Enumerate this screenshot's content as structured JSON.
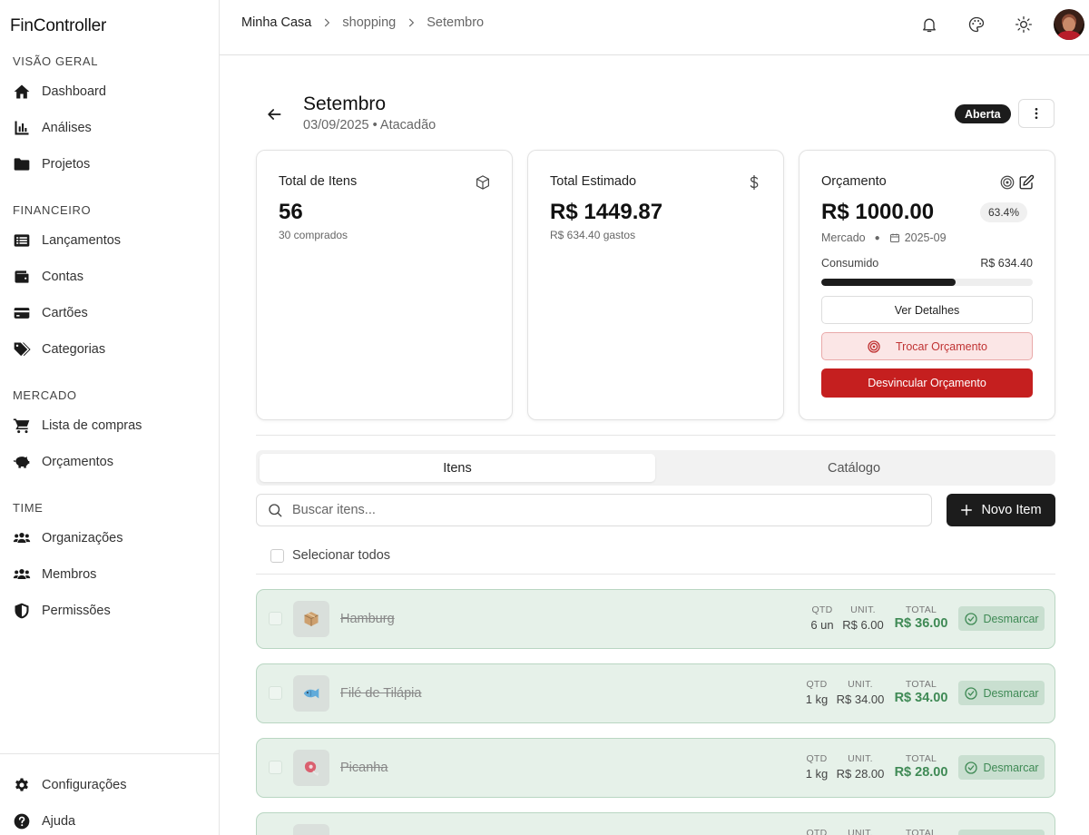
{
  "app": {
    "name": "FinController"
  },
  "sidebar": {
    "sections": [
      {
        "label": "VISÃO GERAL",
        "items": [
          {
            "label": "Dashboard",
            "icon": "home-icon"
          },
          {
            "label": "Análises",
            "icon": "chart-icon"
          },
          {
            "label": "Projetos",
            "icon": "folder-icon"
          }
        ]
      },
      {
        "label": "FINANCEIRO",
        "items": [
          {
            "label": "Lançamentos",
            "icon": "list-icon"
          },
          {
            "label": "Contas",
            "icon": "wallet-icon"
          },
          {
            "label": "Cartões",
            "icon": "credit-card-icon"
          },
          {
            "label": "Categorias",
            "icon": "tags-icon"
          }
        ]
      },
      {
        "label": "MERCADO",
        "items": [
          {
            "label": "Lista de compras",
            "icon": "cart-icon"
          },
          {
            "label": "Orçamentos",
            "icon": "piggy-bank-icon"
          }
        ]
      },
      {
        "label": "TIME",
        "items": [
          {
            "label": "Organizações",
            "icon": "users-icon"
          },
          {
            "label": "Membros",
            "icon": "users-icon"
          },
          {
            "label": "Permissões",
            "icon": "shield-icon"
          }
        ]
      }
    ],
    "footer": [
      {
        "label": "Configurações",
        "icon": "gear-icon"
      },
      {
        "label": "Ajuda",
        "icon": "help-icon"
      }
    ]
  },
  "header": {
    "breadcrumb": [
      "Minha Casa",
      "shopping",
      "Setembro"
    ],
    "icons": [
      "bell-icon",
      "palette-icon",
      "sun-icon"
    ]
  },
  "page": {
    "title": "Setembro",
    "subtitle_date": "03/09/2025",
    "subtitle_store": "Atacadão",
    "status": "Aberta"
  },
  "cards": {
    "items": {
      "title": "Total de Itens",
      "value": "56",
      "sub": "30 comprados"
    },
    "estimated": {
      "title": "Total Estimado",
      "value": "R$ 1449.87",
      "sub": "R$ 634.40 gastos"
    },
    "budget": {
      "title": "Orçamento",
      "value": "R$ 1000.00",
      "percent": "63.4%",
      "category": "Mercado",
      "period": "2025-09",
      "consumed_label": "Consumido",
      "consumed_value": "R$ 634.40",
      "consumed_fraction": 0.634,
      "details_label": "Ver Detalhes",
      "swap_label": "Trocar Orçamento",
      "unlink_label": "Desvincular Orçamento"
    }
  },
  "tabs": [
    {
      "label": "Itens",
      "active": true
    },
    {
      "label": "Catálogo",
      "active": false
    }
  ],
  "search": {
    "placeholder": "Buscar itens..."
  },
  "new_item_label": "Novo Item",
  "select_all_label": "Selecionar todos",
  "list": {
    "headers": {
      "qty": "QTD",
      "unit": "UNIT.",
      "total": "TOTAL"
    },
    "unmark_label": "Desmarcar",
    "items": [
      {
        "name": "Hamburg",
        "qty": "6 un",
        "unit": "R$ 6.00",
        "total": "R$ 36.00",
        "icon": "box-icon"
      },
      {
        "name": "Filé de Tilápia",
        "qty": "1 kg",
        "unit": "R$ 34.00",
        "total": "R$ 34.00",
        "icon": "fish-icon"
      },
      {
        "name": "Picanha",
        "qty": "1 kg",
        "unit": "R$ 28.00",
        "total": "R$ 28.00",
        "icon": "meat-icon"
      },
      {
        "name": "",
        "qty": "",
        "unit": "",
        "total": "",
        "icon": "meat-icon"
      }
    ]
  },
  "colors": {
    "accent": "#1c1c1c",
    "danger": "#c51f1f",
    "success": "#3f8a55",
    "item_bg": "#e6f1e9"
  }
}
